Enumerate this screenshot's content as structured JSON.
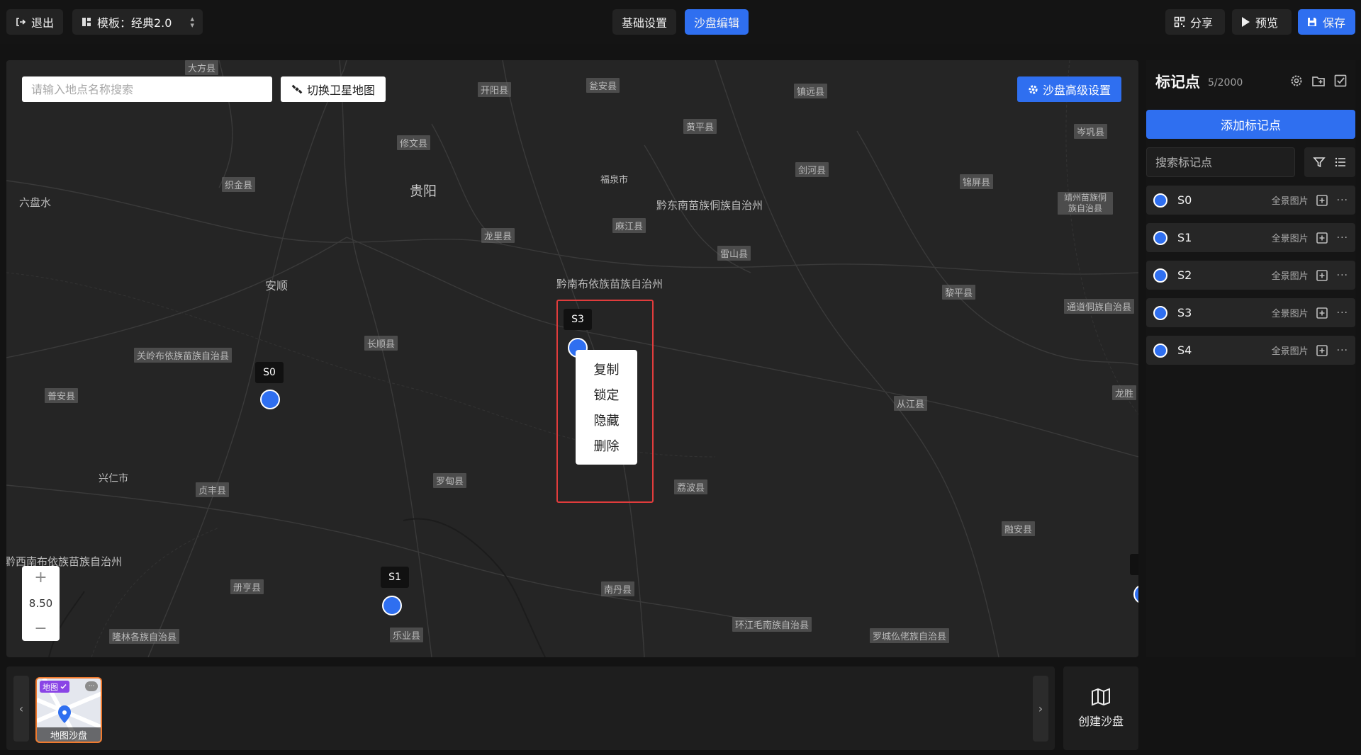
{
  "topbar": {
    "exit_label": "退出",
    "template_label": "模板：经典2.0",
    "tabs": [
      {
        "label": "基础设置",
        "active": false
      },
      {
        "label": "沙盘编辑",
        "active": true
      }
    ],
    "share_label": "分享",
    "preview_label": "预览",
    "save_label": "保存"
  },
  "map": {
    "search_placeholder": "请输入地点名称搜索",
    "satellite_label": "切换卫星地图",
    "advanced_label": "沙盘高级设置",
    "zoom_level": "8.50",
    "zoom_in": "+",
    "zoom_out": "−",
    "place_labels": {
      "dafang": "大方县",
      "kaiyang": "开阳县",
      "wengan": "瓮安县",
      "zhenyuan": "镇远县",
      "xiuwen": "修文县",
      "huangping": "黄平县",
      "cengong": "岑巩县",
      "zhijin": "织金县",
      "jianhe": "剑河县",
      "jinping": "锦屏县",
      "jingzhou": "靖州苗族侗族自治县",
      "majiang": "麻江县",
      "longli": "龙里县",
      "leishan": "雷山县",
      "liping": "黎平县",
      "tongdao": "通道侗族自治县",
      "changshun": "长顺县",
      "guanling": "关岭布依族苗族自治县",
      "puan": "普安县",
      "congjiang": "从江县",
      "longsheng": "龙胜",
      "zhenfeng": "贞丰县",
      "luodian": "罗甸县",
      "libo": "荔波县",
      "rongan": "融安县",
      "ceheng": "册亨县",
      "nandan": "南丹县",
      "huanjiang": "环江毛南族自治县",
      "luocheng": "罗城仫佬族自治县",
      "longlin": "隆林各族自治县",
      "leye": "乐业县"
    },
    "cities": {
      "guiyang": "贵阳",
      "fuquan": "福泉市",
      "qiandongnan": "黔东南苗族侗族自治州",
      "liupanshui": "六盘水",
      "anshun": "安顺",
      "qiannan": "黔南布依族苗族自治州",
      "xingren": "兴仁市",
      "qianxinan": "黔西南布依族苗族自治州"
    },
    "pins": [
      {
        "name": "S0"
      },
      {
        "name": "S1"
      },
      {
        "name": "S3"
      }
    ],
    "context_menu": [
      "复制",
      "锁定",
      "隐藏",
      "删除"
    ]
  },
  "panel": {
    "title": "标记点",
    "count": "5/2000",
    "add_label": "添加标记点",
    "search_placeholder": "搜索标记点",
    "pano_label": "全景图片",
    "markers": [
      {
        "name": "S0"
      },
      {
        "name": "S1"
      },
      {
        "name": "S2"
      },
      {
        "name": "S3"
      },
      {
        "name": "S4"
      }
    ]
  },
  "bottom": {
    "thumb_badge": "地图",
    "thumb_caption": "地图沙盘",
    "create_label": "创建沙盘"
  },
  "colors": {
    "accent": "#2f6ff0",
    "highlight": "#e03c3c",
    "thumb_border": "#f07a2e"
  }
}
